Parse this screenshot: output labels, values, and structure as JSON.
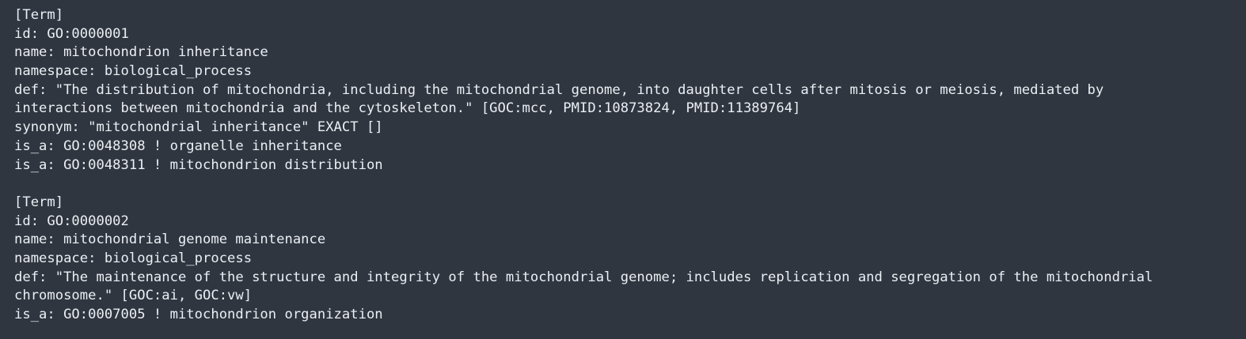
{
  "document": {
    "blocks": [
      {
        "lines": [
          "[Term]",
          "id: GO:0000001",
          "name: mitochondrion inheritance",
          "namespace: biological_process",
          "def: \"The distribution of mitochondria, including the mitochondrial genome, into daughter cells after mitosis or meiosis, mediated by",
          "interactions between mitochondria and the cytoskeleton.\" [GOC:mcc, PMID:10873824, PMID:11389764]",
          "synonym: \"mitochondrial inheritance\" EXACT []",
          "is_a: GO:0048308 ! organelle inheritance",
          "is_a: GO:0048311 ! mitochondrion distribution"
        ]
      },
      {
        "lines": [
          "[Term]",
          "id: GO:0000002",
          "name: mitochondrial genome maintenance",
          "namespace: biological_process",
          "def: \"The maintenance of the structure and integrity of the mitochondrial genome; includes replication and segregation of the mitochondrial",
          "chromosome.\" [GOC:ai, GOC:vw]",
          "is_a: GO:0007005 ! mitochondrion organization"
        ]
      }
    ]
  },
  "colors": {
    "background": "#2f3640",
    "text": "#eceff3"
  }
}
